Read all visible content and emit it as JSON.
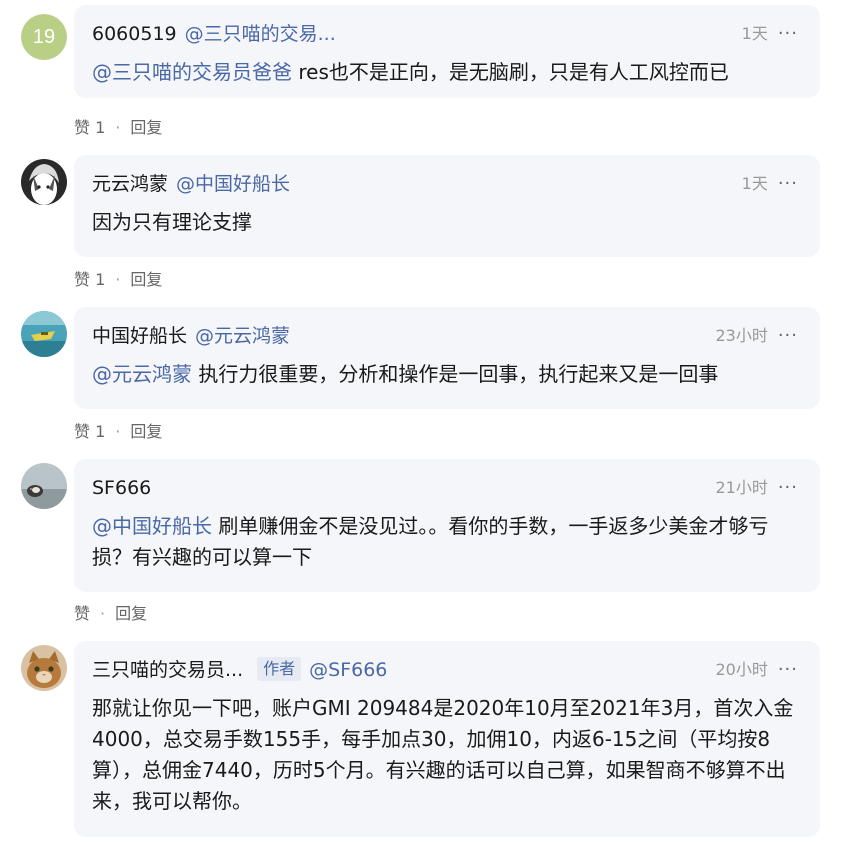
{
  "comments": [
    {
      "avatar_text": "19",
      "user": "6060519",
      "reply_to": "@三只喵的交易...",
      "time": "1天",
      "more": "···",
      "mention": "@三只喵的交易员爸爸",
      "text": " res也不是正向，是无脑刷，只是有人工风控而已",
      "like": "赞 1",
      "reply": "回复"
    },
    {
      "user": "元云鸿蒙",
      "reply_to": "@中国好船长",
      "time": "1天",
      "more": "···",
      "mention": "",
      "text": "因为只有理论支撑",
      "like": "赞 1",
      "reply": "回复"
    },
    {
      "user": "中国好船长",
      "reply_to": "@元云鸿蒙",
      "time": "23小时",
      "more": "···",
      "mention": "@元云鸿蒙",
      "text": " 执行力很重要，分析和操作是一回事，执行起来又是一回事",
      "like": "赞 1",
      "reply": "回复"
    },
    {
      "user": "SF666",
      "reply_to": "",
      "time": "21小时",
      "more": "···",
      "mention": "@中国好船长",
      "text": " 刷单赚佣金不是没见过。。看你的手数，一手返多少美金才够亏损？有兴趣的可以算一下",
      "like": "赞",
      "reply": "回复"
    },
    {
      "user": "三只喵的交易员...",
      "author_tag": "作者",
      "reply_to": "@SF666",
      "time": "20小时",
      "more": "···",
      "mention": "",
      "text": "那就让你见一下吧，账户GMI 209484是2020年10月至2021年3月，首次入金4000，总交易手数155手，每手加点30，加佣10，内返6-15之间（平均按8算），总佣金7440，历时5个月。有兴趣的话可以自己算，如果智商不够算不出来，我可以帮你。"
    }
  ],
  "colors": {
    "bubble_bg": "#f4f6f9",
    "mention": "#4a68a6",
    "meta": "#999999",
    "avatar_19": "#b9cf86"
  },
  "action_separator": "·"
}
